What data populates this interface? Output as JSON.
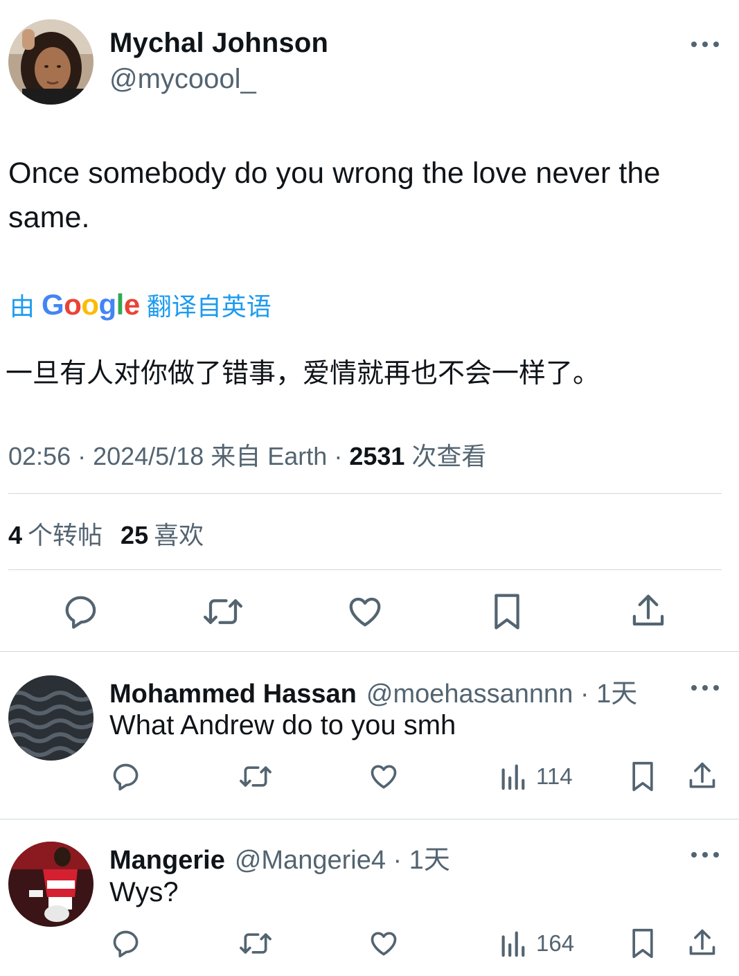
{
  "tweet": {
    "author_name": "Mychal Johnson",
    "author_handle": "@mycoool_",
    "text": "Once somebody do you wrong the love never the same.",
    "translate": {
      "prefix": "由",
      "provider": "Google",
      "suffix": "翻译自英语"
    },
    "translated_text": "一旦有人对你做了错事，爱情就再也不会一样了。",
    "meta": {
      "time": "02:56",
      "sep1": " · ",
      "date": "2024/5/18",
      "source": " 来自 Earth",
      "sep2": " · ",
      "views": "2531",
      "views_label": " 次查看"
    },
    "stats": {
      "reposts": "4",
      "reposts_label": "个转帖",
      "likes": "25",
      "likes_label": "喜欢"
    },
    "icons": [
      "reply-icon",
      "retweet-icon",
      "like-icon",
      "bookmark-icon",
      "share-icon"
    ]
  },
  "replies": [
    {
      "name": "Mohammed Hassan",
      "meta": "@moehassannnn · 1天",
      "text": "What Andrew do to you smh",
      "views": "114"
    },
    {
      "name": "Mangerie",
      "meta": "@Mangerie4 · 1天",
      "text": "Wys?",
      "views": "164"
    }
  ],
  "colors": {
    "text": "#0f1419",
    "secondary": "#536471",
    "link": "#1d9bf0",
    "divider": "#cfd9de"
  }
}
